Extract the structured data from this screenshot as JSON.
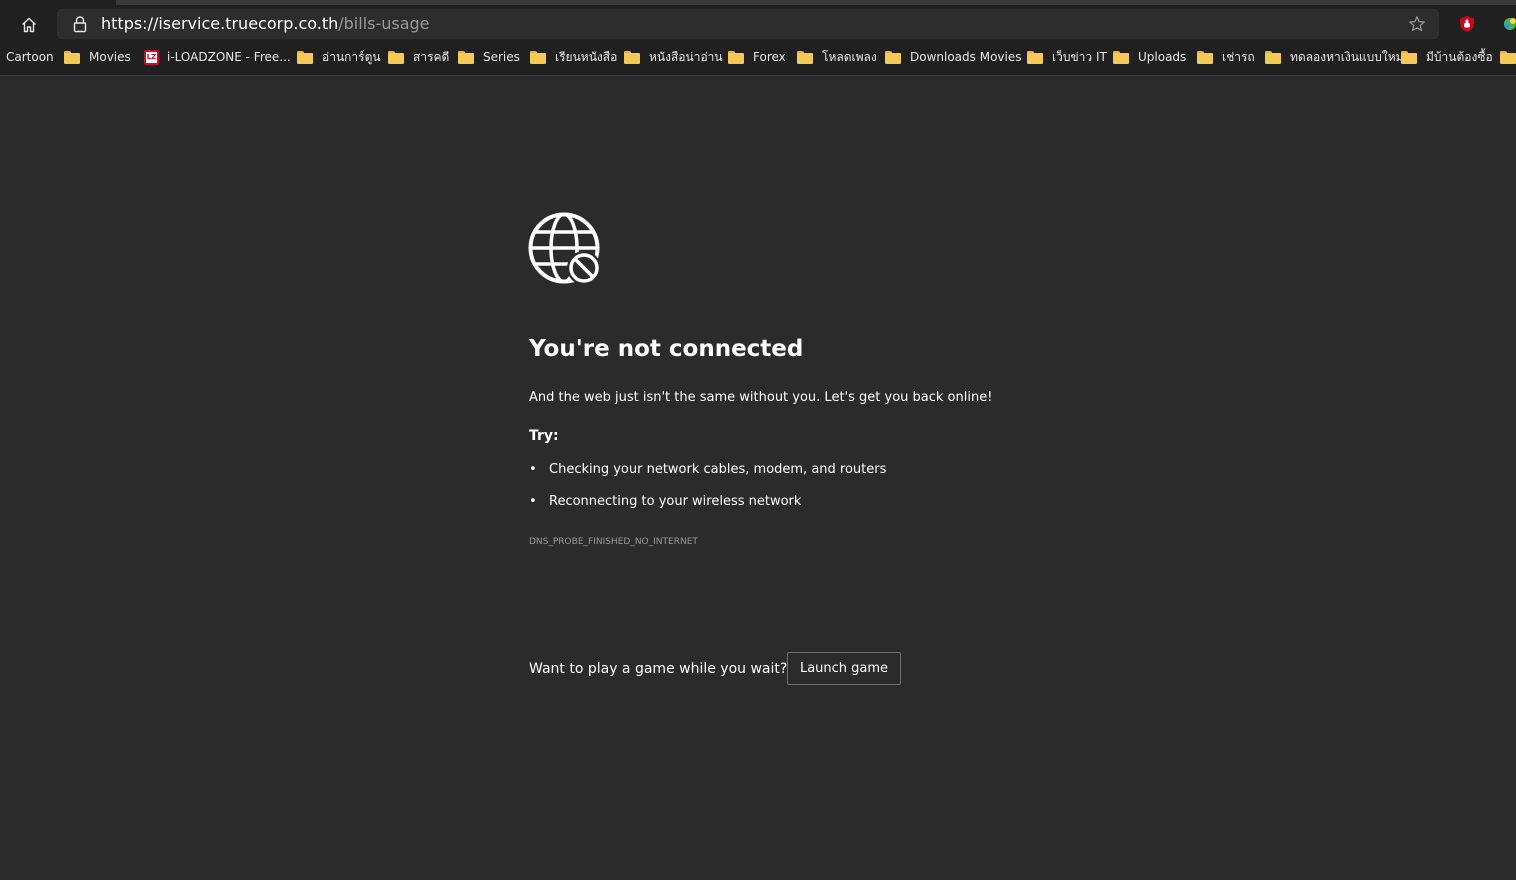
{
  "browser": {
    "url_domain": "https://iservice.truecorp.co.th",
    "url_path": "/bills-usage",
    "home_icon": "home-icon",
    "lock_icon": "lock-icon",
    "favorite_icon": "star-icon",
    "extensions": [
      "shield-extension-icon",
      "extension-icon"
    ]
  },
  "bookmarks": [
    {
      "label": "Cartoon",
      "icon": "none"
    },
    {
      "label": "Movies",
      "icon": "folder-icon"
    },
    {
      "label": "i-LOADZONE - Free...",
      "icon": "loadzone-icon",
      "icon_text": "LZ"
    },
    {
      "label": "อ่านการ์ตูน",
      "icon": "folder-icon"
    },
    {
      "label": "สารคดี",
      "icon": "folder-icon"
    },
    {
      "label": "Series",
      "icon": "folder-icon"
    },
    {
      "label": "เรียนหนังสือ",
      "icon": "folder-icon"
    },
    {
      "label": "หนังสือน่าอ่าน",
      "icon": "folder-icon"
    },
    {
      "label": "Forex",
      "icon": "folder-icon"
    },
    {
      "label": "โหลดเพลง",
      "icon": "folder-icon"
    },
    {
      "label": "Downloads Movies",
      "icon": "folder-icon"
    },
    {
      "label": "เว็บข่าว IT",
      "icon": "folder-icon"
    },
    {
      "label": "Uploads",
      "icon": "folder-icon"
    },
    {
      "label": "เช่ารถ",
      "icon": "folder-icon"
    },
    {
      "label": "ทดลองหาเงินแบบใหม่",
      "icon": "folder-icon"
    },
    {
      "label": "มีบ้านต้องซื้อ",
      "icon": "folder-icon"
    },
    {
      "label": "",
      "icon": "folder-icon"
    }
  ],
  "error_page": {
    "icon": "globe-blocked-icon",
    "title": "You're not connected",
    "lead": "And the web just isn't the same without you. Let's get you back online!",
    "try_heading": "Try:",
    "suggestions": [
      "Checking your network cables, modem, and routers",
      "Reconnecting to your wireless network"
    ],
    "error_code": "DNS_PROBE_FINISHED_NO_INTERNET",
    "game_prompt": "Want to play a game while you wait?",
    "launch_button": "Launch game"
  },
  "colors": {
    "page_background": "#2b2b2b",
    "toolbar_background": "#202020",
    "address_bar_background": "#2d2d2d",
    "folder": "#f5c955",
    "muted_text": "#9a9a9a"
  }
}
